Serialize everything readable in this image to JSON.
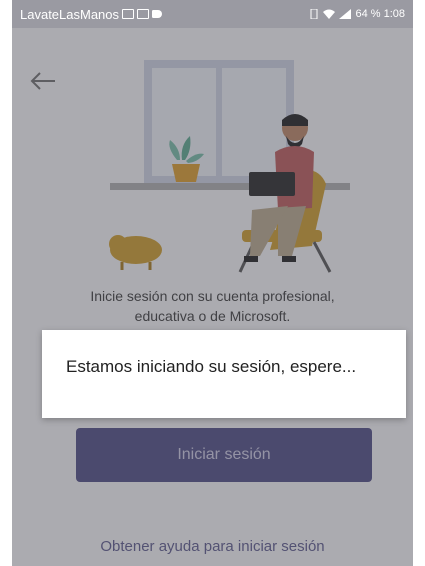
{
  "status_bar": {
    "app_name": "LavateLasManos",
    "right_text": "64 % 1:08"
  },
  "main": {
    "login_text_line1": "Inicie sesión con su cuenta profesional,",
    "login_text_line2": "educativa o de Microsoft.",
    "signin_button_label": "Iniciar sesión",
    "help_link_label": "Obtener ayuda para iniciar sesión"
  },
  "dialog": {
    "message": "Estamos iniciando su sesión, espere..."
  },
  "colors": {
    "accent": "#4f4d82",
    "status_bar": "#9a9aa2"
  }
}
